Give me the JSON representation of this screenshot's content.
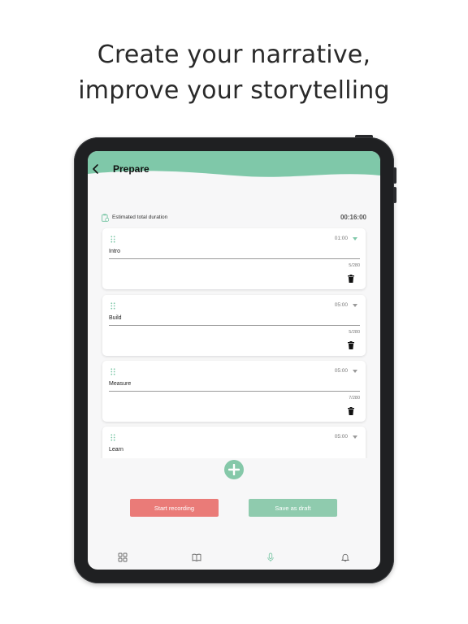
{
  "headline": {
    "line1": "Create your narrative,",
    "line2": "improve your storytelling"
  },
  "header": {
    "title": "Prepare",
    "back_icon": "chevron-left-icon",
    "accent_color": "#7fc8a9"
  },
  "duration": {
    "label": "Estimated total duration",
    "value": "00:16:00",
    "icon": "clock-icon"
  },
  "sections": [
    {
      "time": "01:00",
      "name": "Intro",
      "count": "5/280"
    },
    {
      "time": "05:00",
      "name": "Build",
      "count": "5/280"
    },
    {
      "time": "05:00",
      "name": "Measure",
      "count": "7/280"
    },
    {
      "time": "05:00",
      "name": "Learn",
      "count": ""
    }
  ],
  "actions": {
    "start_recording": "Start recording",
    "save_draft": "Save as draft",
    "record_color": "#ea7b78",
    "draft_color": "#8fcbae"
  },
  "tabbar": {
    "items": [
      {
        "icon": "grid-icon",
        "active": false
      },
      {
        "icon": "book-icon",
        "active": false
      },
      {
        "icon": "microphone-icon",
        "active": true
      },
      {
        "icon": "bell-icon",
        "active": false
      }
    ]
  }
}
